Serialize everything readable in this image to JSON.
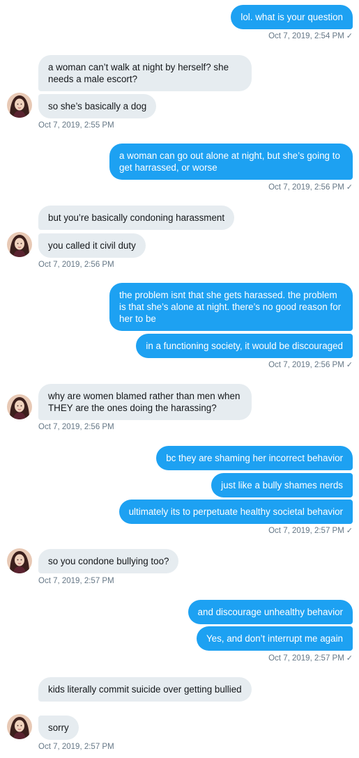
{
  "conversation": {
    "messages": [
      {
        "text": "lol. what is your question"
      },
      {
        "text": "a woman can’t walk at night by herself? she needs a male escort?"
      },
      {
        "text": "so she’s basically a dog"
      },
      {
        "text": "a woman can go out alone at night, but she’s going to get harrassed, or worse"
      },
      {
        "text": "but you’re basically condoning harassment"
      },
      {
        "text": "you called it civil duty"
      },
      {
        "text": "the problem isnt that she gets harassed. the problem is that she’s alone at night. there’s no good reason for her to be"
      },
      {
        "text": "in a functioning society, it would be discouraged"
      },
      {
        "text": "why are women blamed rather than men when THEY are the ones doing the harassing?"
      },
      {
        "text": "bc they are shaming her incorrect behavior"
      },
      {
        "text": "just like a bully shames nerds"
      },
      {
        "text": "ultimately its to perpetuate healthy societal behavior"
      },
      {
        "text": "so you condone bullying too?"
      },
      {
        "text": "and discourage unhealthy behavior"
      },
      {
        "text": "Yes, and don’t interrupt me again"
      },
      {
        "text": "kids literally commit suicide over getting bullied"
      },
      {
        "text": "sorry"
      }
    ],
    "timestamps": [
      {
        "text": "Oct 7, 2019, 2:54 PM",
        "check": "✓"
      },
      {
        "text": "Oct 7, 2019, 2:55 PM"
      },
      {
        "text": "Oct 7, 2019, 2:56 PM",
        "check": "✓"
      },
      {
        "text": "Oct 7, 2019, 2:56 PM"
      },
      {
        "text": "Oct 7, 2019, 2:56 PM",
        "check": "✓"
      },
      {
        "text": "Oct 7, 2019, 2:56 PM"
      },
      {
        "text": "Oct 7, 2019, 2:57 PM",
        "check": "✓"
      },
      {
        "text": "Oct 7, 2019, 2:57 PM"
      },
      {
        "text": "Oct 7, 2019, 2:57 PM",
        "check": "✓"
      },
      {
        "text": "Oct 7, 2019, 2:57 PM"
      }
    ]
  },
  "colors": {
    "sent_bubble": "#1da1f2",
    "received_bubble": "#e6ecf0",
    "timestamp": "#657786"
  },
  "icons": {
    "avatar": "user-avatar",
    "read_receipt": "checkmark-icon"
  }
}
